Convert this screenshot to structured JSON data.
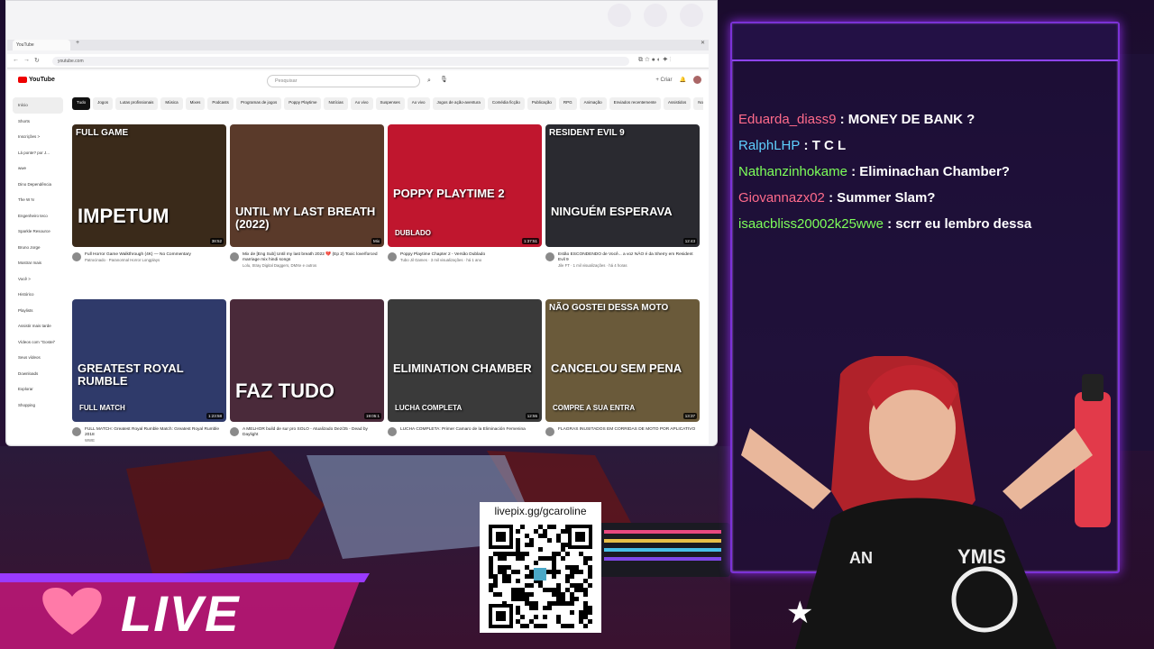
{
  "browser": {
    "tab_label": "YouTube",
    "url": "youtube.com"
  },
  "youtube": {
    "logo_text": "YouTube",
    "search_placeholder": "Pesquisar",
    "create_label": "Criar",
    "sidebar": [
      {
        "label": "Início",
        "active": true
      },
      {
        "label": "Shorts"
      },
      {
        "label": "Inscrições >"
      },
      {
        "label": "Lá ponte? por J..."
      },
      {
        "label": "wwe"
      },
      {
        "label": "Dino Dependência"
      },
      {
        "label": "The W N"
      },
      {
        "label": "Engenheiro teco"
      },
      {
        "label": "Sparkle Resource"
      },
      {
        "label": "Bruno Jorge"
      },
      {
        "label": "Mostrar mais"
      },
      {
        "label": "Você >"
      },
      {
        "label": "Histórico"
      },
      {
        "label": "Playlists"
      },
      {
        "label": "Assistir mais tarde"
      },
      {
        "label": "Vídeos com \"Gostei\""
      },
      {
        "label": "Seus vídeos"
      },
      {
        "label": "Downloads"
      },
      {
        "label": "Explorar"
      },
      {
        "label": "Shopping"
      }
    ],
    "chips": [
      "Tudo",
      "Jogos",
      "Lutas profissionais",
      "Música",
      "Mixes",
      "Podcasts",
      "Programas de jogos",
      "Poppy Playtime",
      "Notícias",
      "Ao vivo",
      "Suspenses",
      "Ao vivo",
      "Jogos de ação-aventura",
      "Comédia ficção",
      "Publicação",
      "RPG",
      "Animação",
      "Enviados recentemente",
      "Assistidos",
      "Novidades para você"
    ],
    "videos": [
      {
        "title": "Full Horror Game Walkthrough (4K) — No Commentary",
        "channel": "Patrocinado · Paranormal Horror Longplays",
        "thumb_text": "IMPETUM",
        "top_text": "FULL GAME",
        "duration": "38:52",
        "bg": "#3a2a1a"
      },
      {
        "title": "Mix de [Eng Sub] Until my last breath 2022 💔 (Ep 2) Toxic love/forced marriage mix hindi songs",
        "channel": "Lolu, Stray Digital Daggers, DMXe e outros",
        "thumb_text": "UNTIL MY LAST BREATH (2022)",
        "duration": "Mix",
        "bg": "#5a3a2a"
      },
      {
        "title": "Poppy Playtime Chapter 2 - Versão Dublado",
        "channel": "Tubo Jil Games · 3 mil visualizações · há 1 ano",
        "thumb_text": "POPPY PLAYTIME 2",
        "sub_text": "DUBLADO",
        "duration": "1:37:51",
        "bg": "#c0162e"
      },
      {
        "title": "Estão ESCONDENDO de Você... a voz NÃO é da Sherry em Resident Evil 9",
        "channel": "Jile FT · 1 mil visualizações · há 4 horas",
        "thumb_text": "NINGUÉM ESPERAVA",
        "top_text": "RESIDENT EVIL 9",
        "duration": "12:43",
        "bg": "#2a2a30"
      },
      {
        "title": "FULL MATCH: Greatest Royal Rumble Match: Greatest Royal Rumble 2018",
        "channel": "WWE",
        "thumb_text": "GREATEST ROYAL RUMBLE",
        "sub_text": "FULL MATCH",
        "duration": "1:23:58",
        "bg": "#2f3a6a"
      },
      {
        "title": "A MELHOR build de sur pro SOLO - Atualizado Dez/25 - Dead by Daylight",
        "channel": "",
        "thumb_text": "FAZ TUDO",
        "duration": "19:05:1",
        "bg": "#4a2a3a"
      },
      {
        "title": "LUCHA COMPLETA: Primer Camaro de la Eliminación Femenina",
        "channel": "",
        "thumb_text": "ELIMINATION CHAMBER",
        "sub_text": "LUCHA COMPLETA",
        "duration": "12:55",
        "bg": "#3a3a3a"
      },
      {
        "title": "FLAGRAS INUSITADOS EM CORRIDAS DE MOTO POR APLICATIVO",
        "channel": "",
        "thumb_text": "CANCELOU SEM PENA",
        "sub_text": "COMPRE A SUA ENTRA",
        "top_text": "NÃO GOSTEI DESSA MOTO",
        "duration": "13:37",
        "bg": "#6a5a3a"
      }
    ]
  },
  "chat": {
    "messages": [
      {
        "user": "Eduarda_diass9",
        "text": "MONEY DE BANK ?",
        "color": "#ff6b8b"
      },
      {
        "user": "RalphLHP",
        "text": "T C L",
        "color": "#5fd0ff"
      },
      {
        "user": "Nathanzinhokame",
        "text": "Eliminachan Chamber?",
        "color": "#7dff5a"
      },
      {
        "user": "Giovannazx02",
        "text": "Summer Slam?",
        "color": "#ff6b8b"
      },
      {
        "user": "isaacbliss20002k25wwe",
        "text": "scrr eu lembro dessa",
        "color": "#7dff5a"
      }
    ]
  },
  "qr": {
    "label": "livepix.gg/gcaroline"
  },
  "live_banner": {
    "text": "LIVE"
  }
}
